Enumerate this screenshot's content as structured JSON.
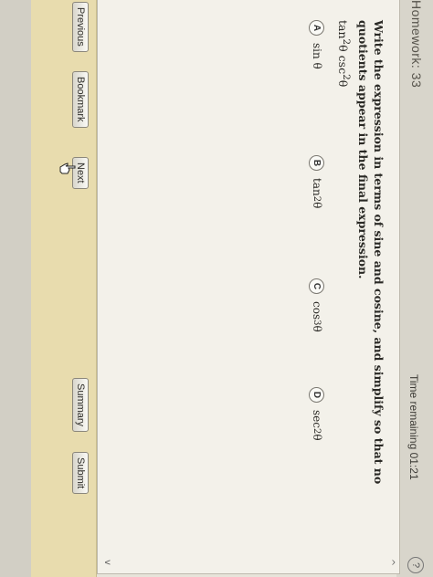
{
  "header": {
    "assignment_label": "Homework: 33",
    "time_remaining": "Time remaining 01:21",
    "help_symbol": "?"
  },
  "question": {
    "prompt": "Write the expression in terms of sine and cosine, and simplify so that no quotients appear in the final expression.",
    "expression_base": "tan",
    "expression_exp1": "2",
    "expression_mid": "θ csc",
    "expression_exp2": "2",
    "expression_end": "θ"
  },
  "choices": [
    {
      "letter": "A",
      "base": "sin θ",
      "exp": "",
      "tail": ""
    },
    {
      "letter": "B",
      "base": "tan",
      "exp": "2",
      "tail": "θ"
    },
    {
      "letter": "C",
      "base": "cos",
      "exp": "3",
      "tail": "θ"
    },
    {
      "letter": "D",
      "base": "sec",
      "exp": "2",
      "tail": "θ"
    }
  ],
  "nav": {
    "previous": "Previous",
    "bookmark": "Bookmark",
    "next": "Next",
    "summary": "Summary",
    "submit": "Submit"
  },
  "scroll": {
    "up_symbol": "^",
    "down_symbol": "v"
  }
}
